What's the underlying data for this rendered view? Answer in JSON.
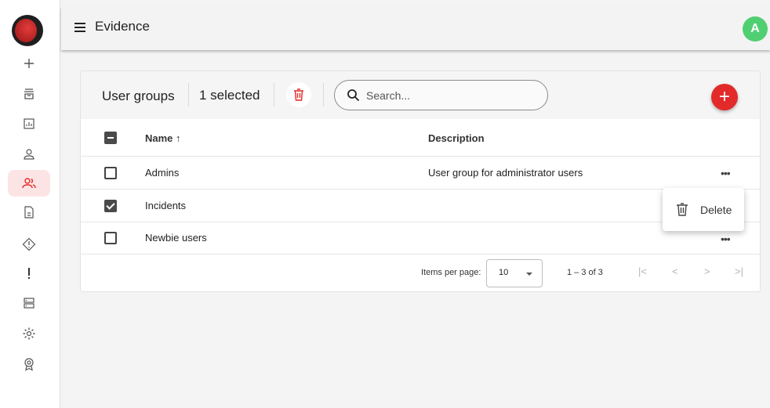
{
  "app": {
    "title": "Evidence",
    "avatar_initial": "A"
  },
  "sidebar": {
    "items": [
      {
        "name": "add",
        "icon": "plus-icon",
        "active": false
      },
      {
        "name": "archive",
        "icon": "archive-icon",
        "active": false
      },
      {
        "name": "reports",
        "icon": "chart-icon",
        "active": false
      },
      {
        "name": "user",
        "icon": "person-icon",
        "active": false
      },
      {
        "name": "user-groups",
        "icon": "group-icon",
        "active": true
      },
      {
        "name": "documents",
        "icon": "document-icon",
        "active": false
      },
      {
        "name": "warnings",
        "icon": "diamond-alert-icon",
        "active": false
      },
      {
        "name": "alerts",
        "icon": "exclamation-icon",
        "active": false
      },
      {
        "name": "storage",
        "icon": "server-icon",
        "active": false
      },
      {
        "name": "settings",
        "icon": "gear-icon",
        "active": false
      },
      {
        "name": "badges",
        "icon": "award-icon",
        "active": false
      }
    ]
  },
  "toolbar": {
    "title": "User groups",
    "selected_text": "1 selected",
    "search_placeholder": "Search...",
    "add_label": "+"
  },
  "table": {
    "columns": {
      "name": "Name ↑",
      "description": "Description"
    },
    "rows": [
      {
        "name": "Admins",
        "description": "User group for administrator users",
        "checked": false,
        "more": "•••"
      },
      {
        "name": "Incidents",
        "description": "",
        "checked": true,
        "more": ""
      },
      {
        "name": "Newbie users",
        "description": "",
        "checked": false,
        "more": "•••"
      }
    ]
  },
  "paginator": {
    "items_per_page_label": "Items per page:",
    "items_per_page": "10",
    "range": "1 – 3 of 3",
    "first": "|<",
    "prev": "<",
    "next": ">",
    "last": ">|"
  },
  "context_menu": {
    "delete_label": "Delete"
  },
  "colors": {
    "accent": "#e32a2a",
    "avatar": "#4fcf72",
    "active_nav": "#fde4e4"
  }
}
